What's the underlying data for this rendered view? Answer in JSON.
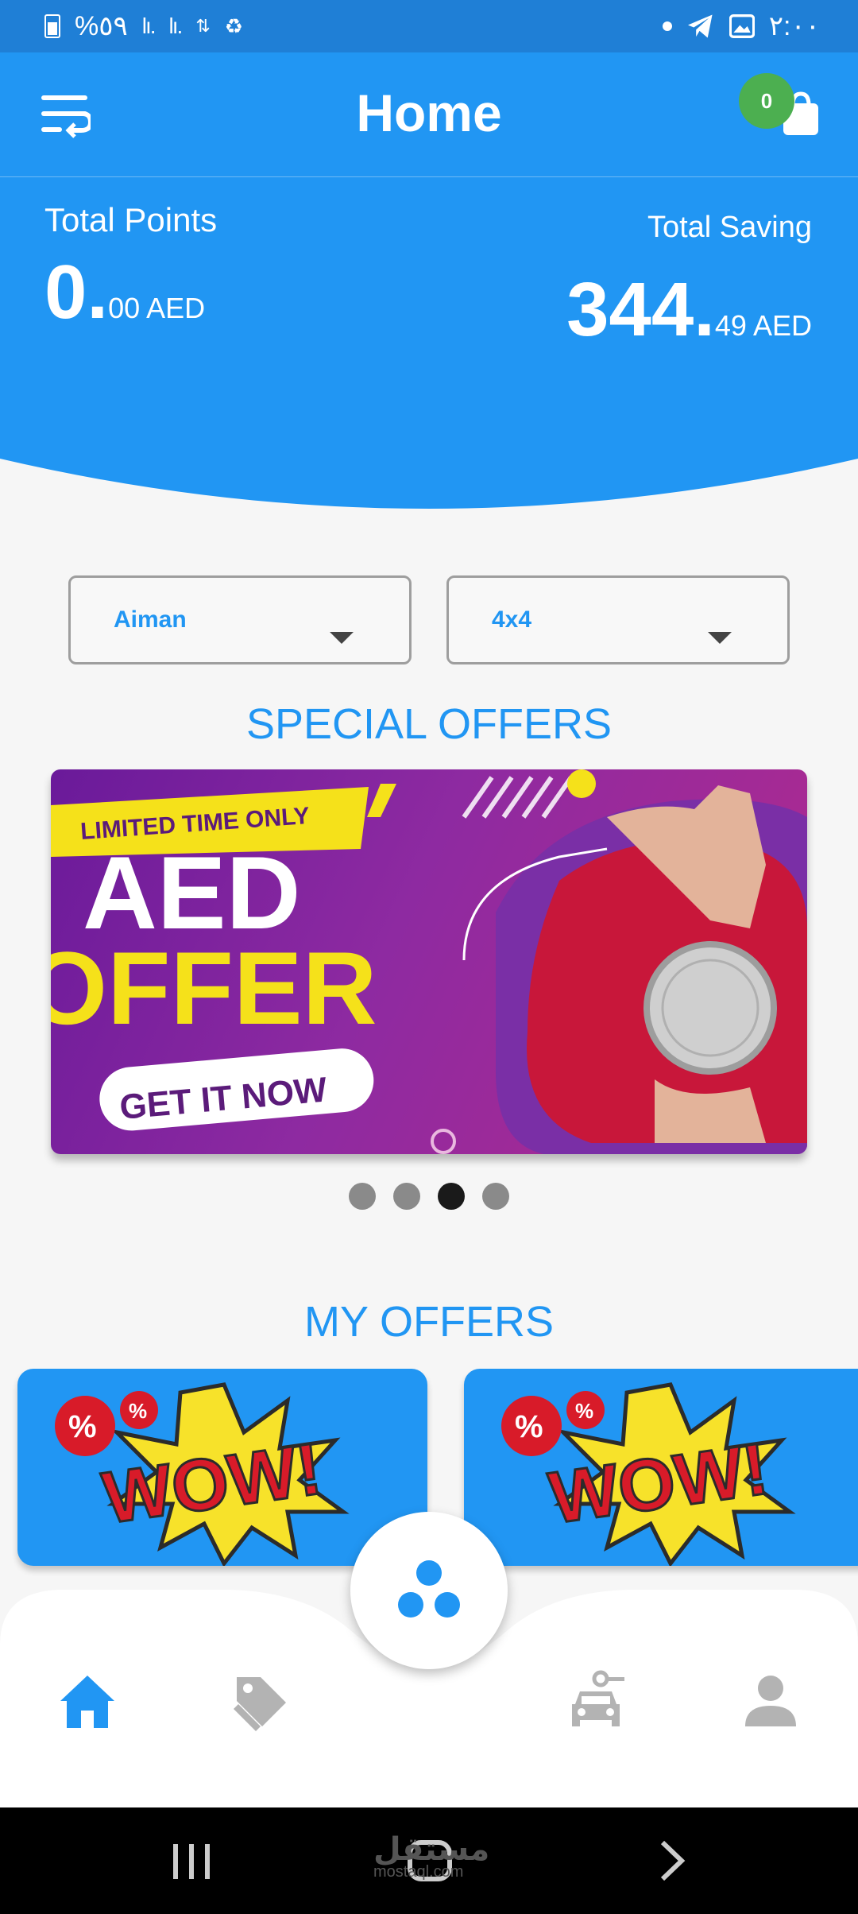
{
  "status_bar": {
    "battery_text": "%٥٩",
    "time": "٢:٠٠"
  },
  "header": {
    "title": "Home",
    "cart_count": "0"
  },
  "summary": {
    "points_label": "Total Points",
    "points_int": "0.",
    "points_dec": "00 AED",
    "saving_label": "Total Saving",
    "saving_int": "344.",
    "saving_dec": "49 AED"
  },
  "filters": {
    "city": "Aiman",
    "vehicle": "4x4"
  },
  "special_offers": {
    "title": "SPECIAL OFFERS",
    "banner_tag": "LIMITED TIME ONLY",
    "banner_line1": "AED",
    "banner_line2": "OFFER",
    "banner_cta": "GET IT NOW",
    "carousel": {
      "count": 4,
      "active_index": 2
    }
  },
  "my_offers": {
    "title": "MY OFFERS",
    "cards": [
      {
        "label": "WOW!"
      },
      {
        "label": "WOW!"
      }
    ]
  },
  "bottom_nav": {
    "items": [
      {
        "icon": "home-icon",
        "active": true
      },
      {
        "icon": "tags-icon",
        "active": false
      },
      {
        "icon": "car-key-icon",
        "active": false
      },
      {
        "icon": "person-icon",
        "active": false
      }
    ],
    "fab_icon": "three-dots-icon",
    "colors": {
      "active": "#2196f3",
      "inactive": "#b3b3b3"
    }
  },
  "watermark": {
    "text": "مستقل",
    "sub": "mostaql.com"
  }
}
